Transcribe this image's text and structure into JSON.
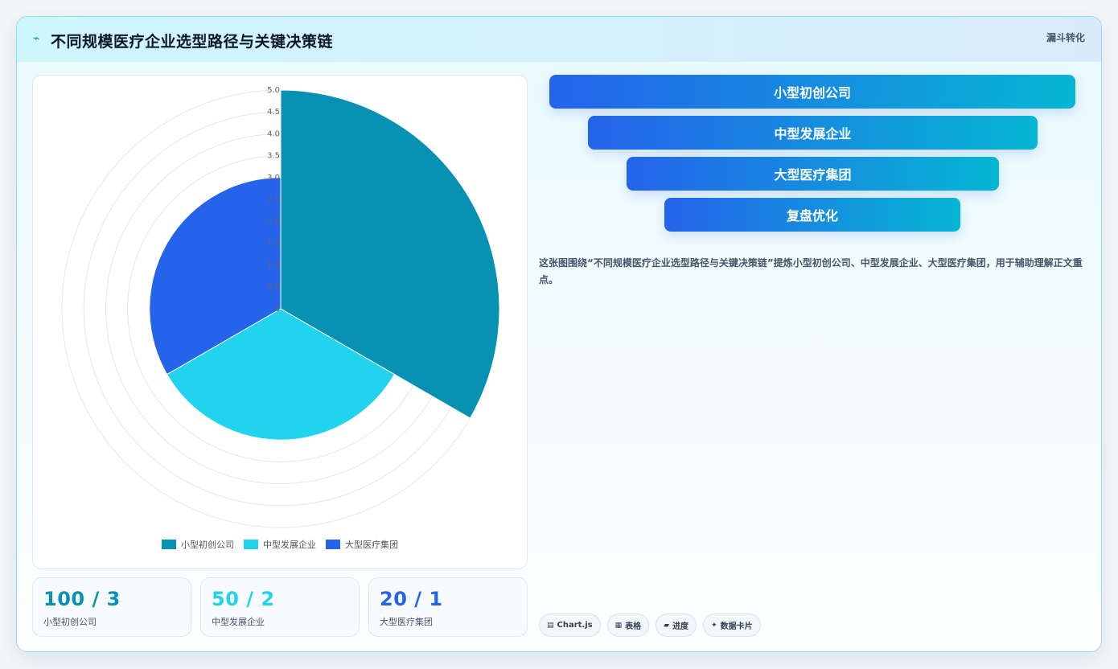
{
  "header": {
    "title": "不同规模医疗企业选型路径与关键决策链",
    "tag": "漏斗转化"
  },
  "chart_data": {
    "type": "polarArea",
    "categories": [
      "小型初创公司",
      "中型发展企业",
      "大型医疗集团"
    ],
    "values": [
      5,
      3,
      3
    ],
    "colors": [
      "#0891b2",
      "#22d3ee",
      "#2563eb"
    ],
    "r_ticks": [
      "5.0",
      "4.5",
      "4.0",
      "3.5",
      "3.0",
      "2.5",
      "2.0",
      "1.5",
      "1.0",
      "0.5",
      "0"
    ],
    "rlim": [
      0,
      5
    ],
    "grid": true,
    "legend_position": "bottom"
  },
  "stats": [
    {
      "value": "100 / 3",
      "label": "小型初创公司",
      "color": "#0891b2"
    },
    {
      "value": "50 / 2",
      "label": "中型发展企业",
      "color": "#22d3ee"
    },
    {
      "value": "20 / 1",
      "label": "大型医疗集团",
      "color": "#2563eb"
    }
  ],
  "funnel": [
    "小型初创公司",
    "中型发展企业",
    "大型医疗集团",
    "复盘优化"
  ],
  "description": "这张图围绕“不同规模医疗企业选型路径与关键决策链”提炼小型初创公司、中型发展企业、大型医疗集团，用于辅助理解正文重点。",
  "chips": [
    {
      "icon": "chart-icon",
      "glyph": "▤",
      "label": "Chart.js"
    },
    {
      "icon": "table-icon",
      "glyph": "▦",
      "label": "表格"
    },
    {
      "icon": "progress-icon",
      "glyph": "▰",
      "label": "进度"
    },
    {
      "icon": "card-icon",
      "glyph": "✦",
      "label": "数据卡片"
    }
  ]
}
